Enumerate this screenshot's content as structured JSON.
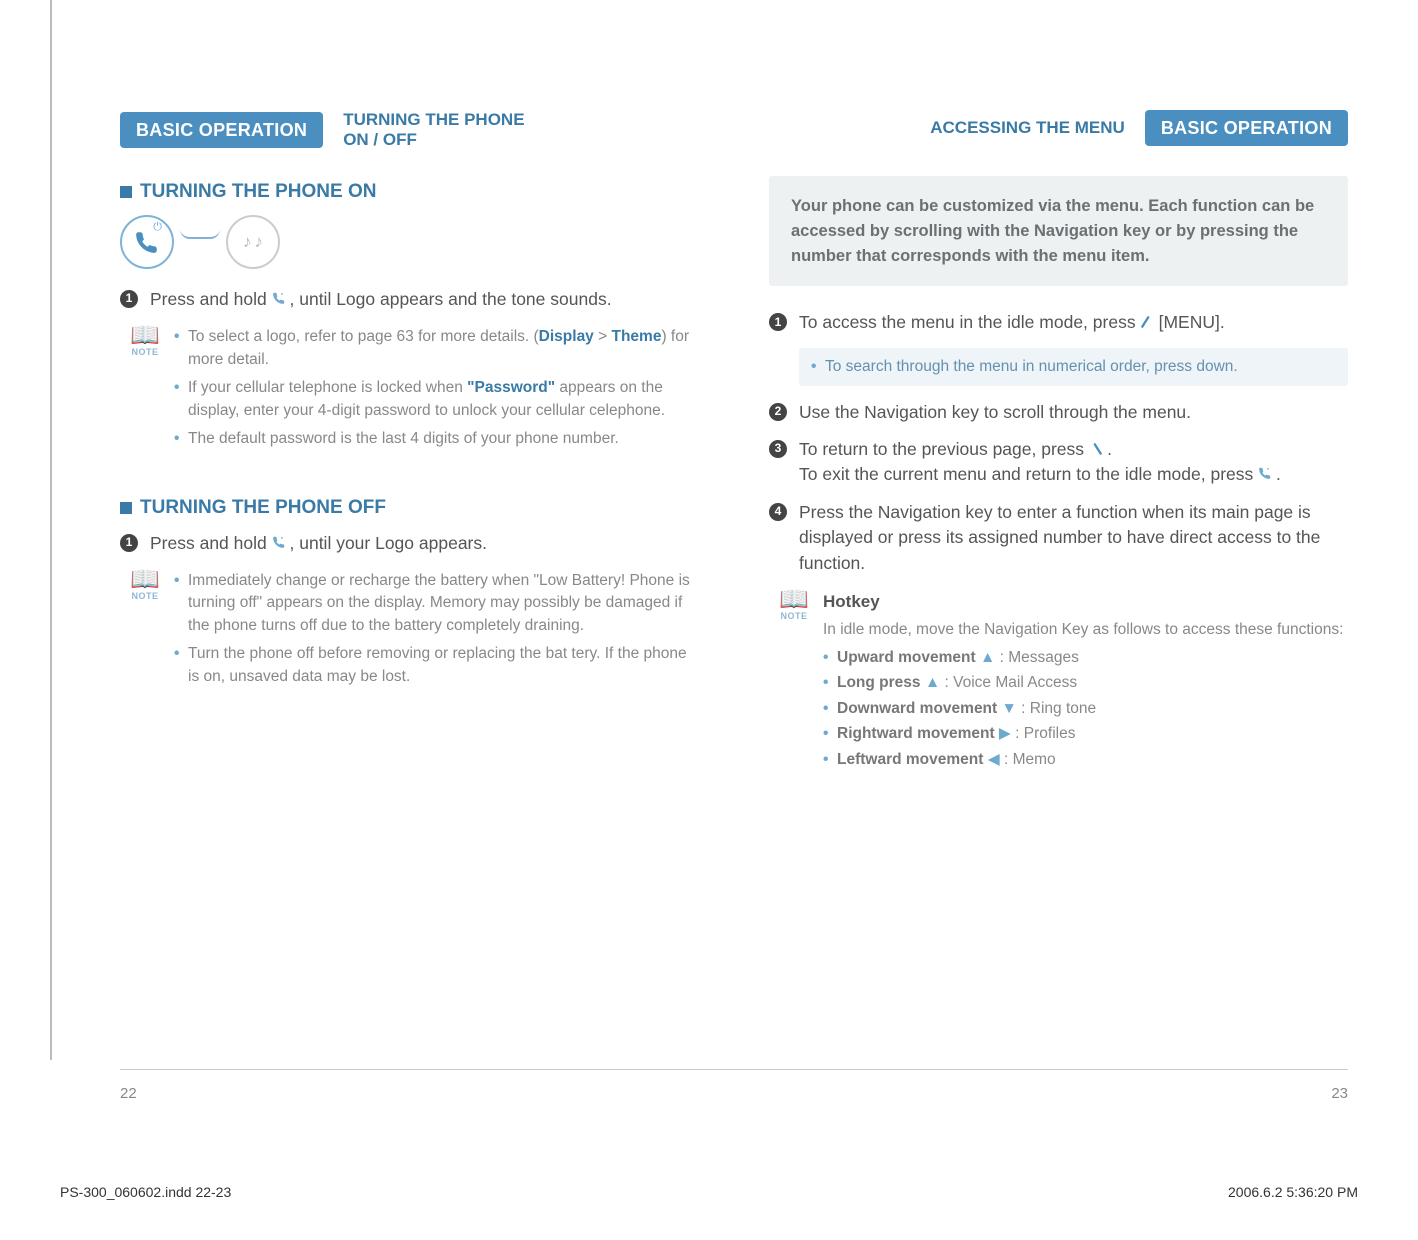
{
  "left": {
    "tab": "BASIC OPERATION",
    "sub1": "TURNING THE PHONE",
    "sub2": "ON / OFF",
    "sect_on": "TURNING THE PHONE ON",
    "step1a": "Press and hold ",
    "step1b": " , until Logo appears and the tone sounds.",
    "note1_a_pre": "To select a logo, refer to page 63 for more details. (",
    "note1_a_disp": "Display",
    "note1_a_gt": " > ",
    "note1_a_theme": "Theme",
    "note1_a_post": ") for more detail.",
    "note1_b_pre": "If your cellular telephone is locked when ",
    "note1_b_pw": "\"Password\"",
    "note1_b_post": " appears on the display, enter your 4-digit password to unlock your cellular celephone.",
    "note1_c": "The default password is the last 4 digits of your phone number.",
    "sect_off": "TURNING THE PHONE OFF",
    "step_off_a": "Press and hold ",
    "step_off_b": " ,  until your Logo appears.",
    "note2_a": "Immediately change or recharge the battery when \"Low Battery! Phone is turning off\" appears on the display. Memory may possibly be damaged if the phone turns off due to the battery completely draining.",
    "note2_b": "Turn the phone off before removing or replacing the bat tery. If the phone is on, unsaved data may be lost."
  },
  "right": {
    "sub": "ACCESSING THE MENU",
    "tab": "BASIC OPERATION",
    "intro": "Your phone can be customized via the menu. Each function can be accessed by scrolling with the Navigation key or by pressing the number that corresponds with the menu item.",
    "s1a": "To access the menu in the idle mode, press ",
    "s1b": " [MENU].",
    "search": "To search through the menu in numerical order, press down.",
    "s2": "Use the Navigation key to scroll through the menu.",
    "s3a": "To return to the previous page, press ",
    "s3b": " .",
    "s3c": "To exit the current menu and return to the idle mode, press ",
    "s3d": " .",
    "s4": "Press the Navigation key to enter a function when its main page is displayed or press its assigned number  to have direct access to the function.",
    "hot_title": "Hotkey",
    "hot_intro": "In idle mode, move the Navigation Key as follows to access these functions:",
    "h1a": "Upward movement",
    "h1b": " : Messages",
    "h2a": "Long press",
    "h2b": " : Voice Mail Access",
    "h3a": "Downward movement",
    "h3b": " : Ring tone",
    "h4a": "Rightward movement",
    "h4b": " : Profiles",
    "h5a": "Leftward movement",
    "h5b": " : Memo"
  },
  "page_left": "22",
  "page_right": "23",
  "footer_left": "PS-300_060602.indd   22-23",
  "footer_right": "2006.6.2   5:36:20 PM",
  "note_label": "NOTE"
}
